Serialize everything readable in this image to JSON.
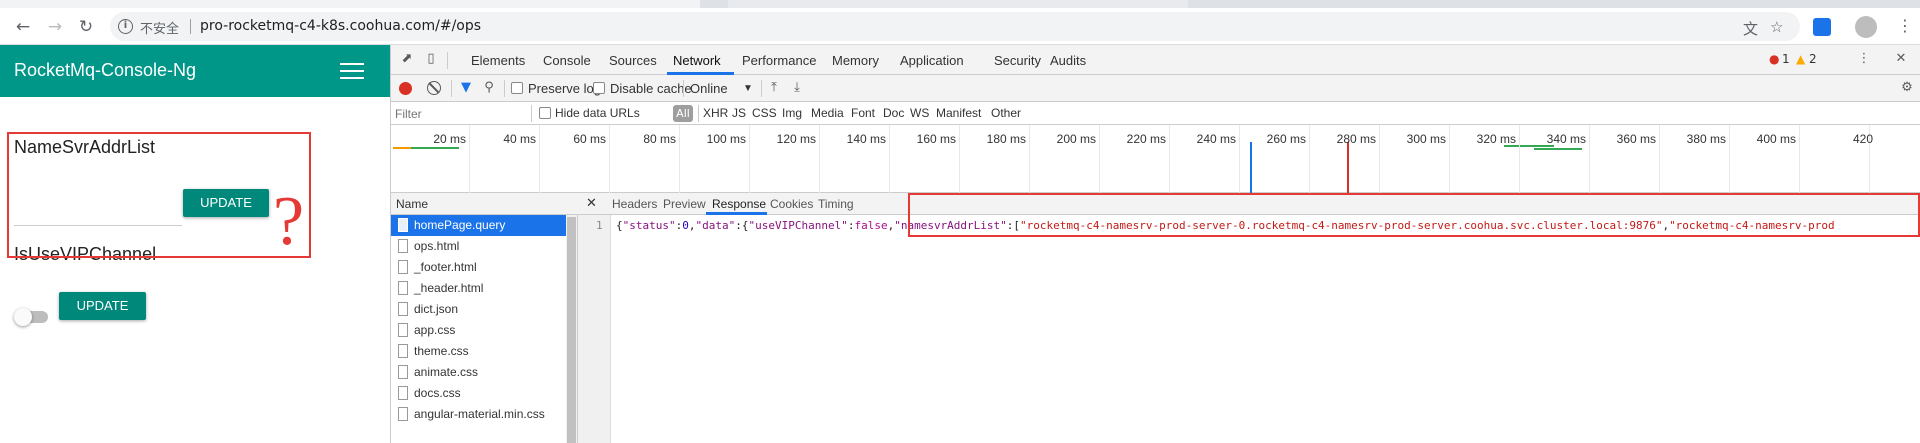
{
  "browser": {
    "security_label": "不安全",
    "url": "pro-rocketmq-c4-k8s.coohua.com/#/ops"
  },
  "app": {
    "title": "RocketMq-Console-Ng",
    "namesrv_label": "NameSvrAddrList",
    "update_label": "UPDATE",
    "vip_label": "IsUseVIPChannel",
    "vip_enabled": false,
    "annotation_mark": "?"
  },
  "devtools": {
    "tabs": [
      "Elements",
      "Console",
      "Sources",
      "Network",
      "Performance",
      "Memory",
      "Application",
      "Security",
      "Audits"
    ],
    "active_tab": "Network",
    "error_count": "1",
    "warning_count": "2",
    "toolbar": {
      "preserve_log": "Preserve log",
      "disable_cache": "Disable cache",
      "throttle": "Online"
    },
    "filter": {
      "placeholder": "Filter",
      "hide_data_urls": "Hide data URLs",
      "types": [
        "All",
        "XHR",
        "JS",
        "CSS",
        "Img",
        "Media",
        "Font",
        "Doc",
        "WS",
        "Manifest",
        "Other"
      ]
    },
    "timeline_ticks": [
      "20 ms",
      "40 ms",
      "60 ms",
      "80 ms",
      "100 ms",
      "120 ms",
      "140 ms",
      "160 ms",
      "180 ms",
      "200 ms",
      "220 ms",
      "240 ms",
      "260 ms",
      "280 ms",
      "300 ms",
      "320 ms",
      "340 ms",
      "360 ms",
      "380 ms",
      "400 ms",
      "420"
    ],
    "name_header": "Name",
    "files": [
      "homePage.query",
      "ops.html",
      "_footer.html",
      "_header.html",
      "dict.json",
      "app.css",
      "theme.css",
      "animate.css",
      "docs.css",
      "angular-material.min.css"
    ],
    "selected_file": "homePage.query",
    "detail_tabs": [
      "Headers",
      "Preview",
      "Response",
      "Cookies",
      "Timing"
    ],
    "active_detail_tab": "Response",
    "response": {
      "line_number": "1",
      "status_key": "\"status\"",
      "status_val": "0",
      "data_key": "\"data\"",
      "vip_key": "\"useVIPChannel\"",
      "vip_val": "false",
      "addr_key": "\"namesvrAddrList\"",
      "addr_1": "\"rocketmq-c4-namesrv-prod-server-0.rocketmq-c4-namesrv-prod-server.coohua.svc.cluster.local:9876\"",
      "addr_2": "\"rocketmq-c4-namesrv-prod"
    }
  }
}
